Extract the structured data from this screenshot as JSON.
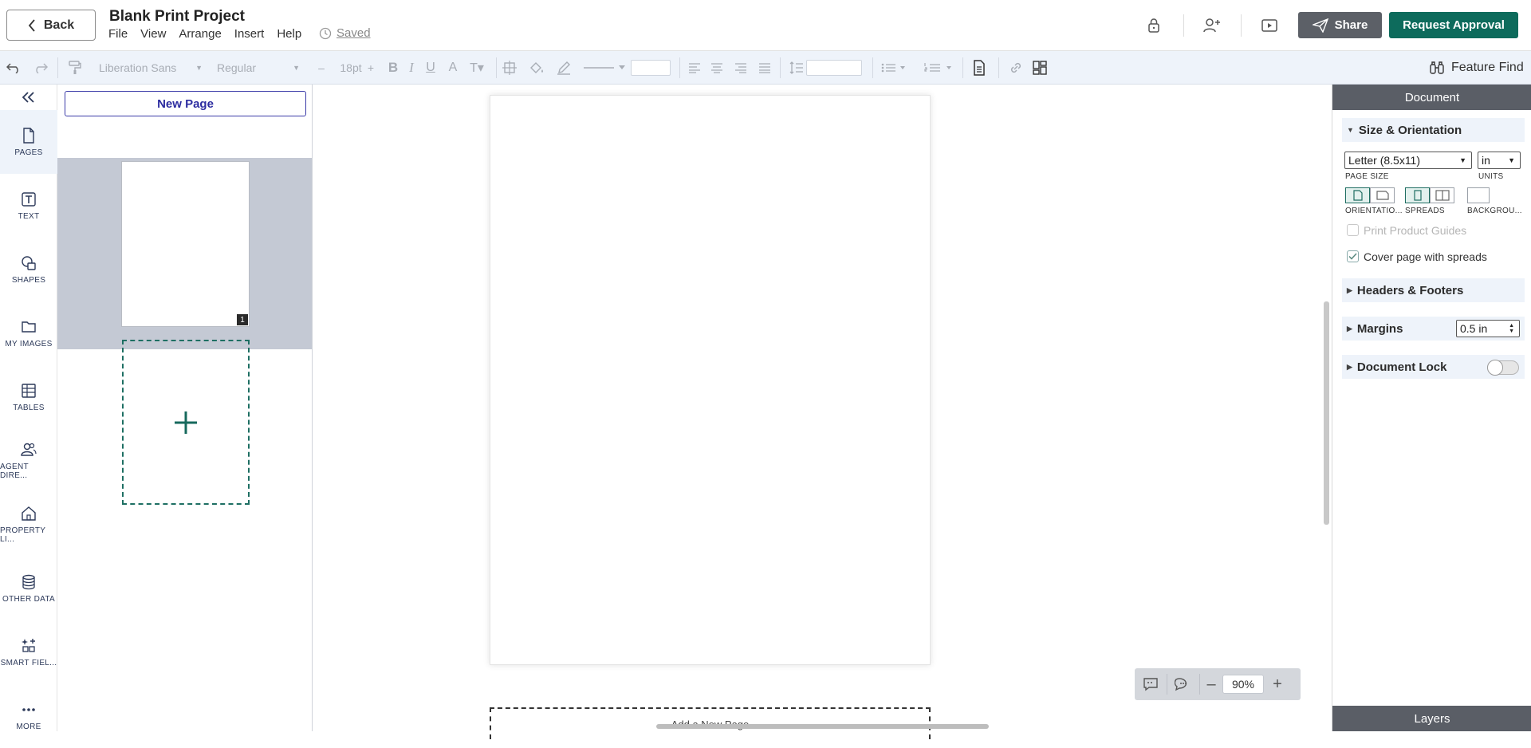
{
  "header": {
    "back_label": "Back",
    "project_title": "Blank Print Project",
    "menu": [
      "File",
      "View",
      "Arrange",
      "Insert",
      "Help"
    ],
    "saved_label": "Saved",
    "share_label": "Share",
    "approval_label": "Request Approval"
  },
  "toolbar": {
    "font_family": "Liberation Sans",
    "font_weight": "Regular",
    "font_size": "18pt",
    "feature_find_label": "Feature Find"
  },
  "rail": {
    "items": [
      {
        "label": "PAGES",
        "icon": "page-icon"
      },
      {
        "label": "TEXT",
        "icon": "text-icon"
      },
      {
        "label": "SHAPES",
        "icon": "shapes-icon"
      },
      {
        "label": "MY IMAGES",
        "icon": "folder-icon"
      },
      {
        "label": "TABLES",
        "icon": "table-icon"
      },
      {
        "label": "AGENT DIRE...",
        "icon": "people-icon"
      },
      {
        "label": "PROPERTY LI...",
        "icon": "house-icon"
      },
      {
        "label": "OTHER DATA",
        "icon": "database-icon"
      },
      {
        "label": "SMART FIEL...",
        "icon": "smart-field-icon"
      },
      {
        "label": "MORE",
        "icon": "more-icon"
      }
    ]
  },
  "pages_panel": {
    "new_page_label": "New Page",
    "thumbnail_number": "1"
  },
  "canvas": {
    "add_page_label": "Add a New Page",
    "zoom_value": "90%"
  },
  "right_panel": {
    "title": "Document",
    "size_section": "Size & Orientation",
    "page_size_value": "Letter (8.5x11)",
    "page_size_label": "PAGE SIZE",
    "units_value": "in",
    "units_label": "UNITS",
    "orientation_label": "ORIENTATIO...",
    "spreads_label": "SPREADS",
    "background_label": "BACKGROU...",
    "print_guides_label": "Print Product Guides",
    "cover_spreads_label": "Cover page with spreads",
    "headers_section": "Headers & Footers",
    "margins_section": "Margins",
    "margins_value": "0.5 in",
    "lock_section": "Document Lock",
    "layers_label": "Layers"
  },
  "colors": {
    "accent_green": "#0d6b5c",
    "share_gray": "#5c6067",
    "toolbar_bg": "#eef3fa"
  }
}
